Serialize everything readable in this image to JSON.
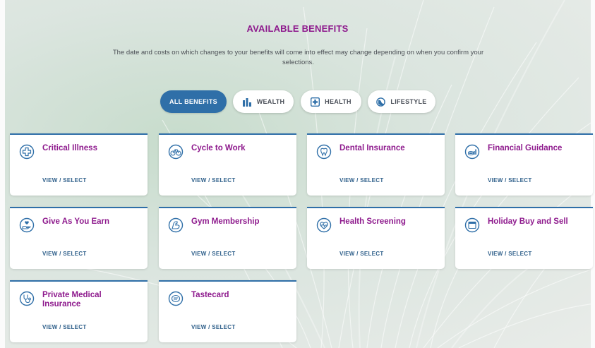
{
  "page": {
    "title": "AVAILABLE BENEFITS",
    "subtitle": "The date and costs on which changes to your benefits will come into effect may change depending on when you confirm your selections."
  },
  "filters": [
    {
      "label": "ALL BENEFITS",
      "icon": "none",
      "active": true
    },
    {
      "label": "WEALTH",
      "icon": "bar-chart-icon",
      "active": false
    },
    {
      "label": "HEALTH",
      "icon": "medical-cross-icon",
      "active": false
    },
    {
      "label": "LIFESTYLE",
      "icon": "globe-icon",
      "active": false
    }
  ],
  "benefits": [
    {
      "name": "Critical Illness",
      "link": "VIEW / SELECT",
      "icon": "medical-cross-icon"
    },
    {
      "name": "Cycle to Work",
      "link": "VIEW / SELECT",
      "icon": "bicycle-icon"
    },
    {
      "name": "Dental Insurance",
      "link": "VIEW / SELECT",
      "icon": "tooth-icon"
    },
    {
      "name": "Financial Guidance",
      "link": "VIEW / SELECT",
      "icon": "coins-chart-icon"
    },
    {
      "name": "Give As You Earn",
      "link": "VIEW / SELECT",
      "icon": "hand-heart-icon"
    },
    {
      "name": "Gym Membership",
      "link": "VIEW / SELECT",
      "icon": "flexed-arm-icon"
    },
    {
      "name": "Health Screening",
      "link": "VIEW / SELECT",
      "icon": "heartbeat-icon"
    },
    {
      "name": "Holiday Buy and Sell",
      "link": "VIEW / SELECT",
      "icon": "calendar-icon"
    },
    {
      "name": "Private Medical Insurance",
      "link": "VIEW / SELECT",
      "icon": "stethoscope-icon"
    },
    {
      "name": "Tastecard",
      "link": "VIEW / SELECT",
      "icon": "card-icon"
    }
  ],
  "colors": {
    "accent": "#2f6fa8",
    "title": "#8e1a8d",
    "link": "#2e5f8a"
  }
}
